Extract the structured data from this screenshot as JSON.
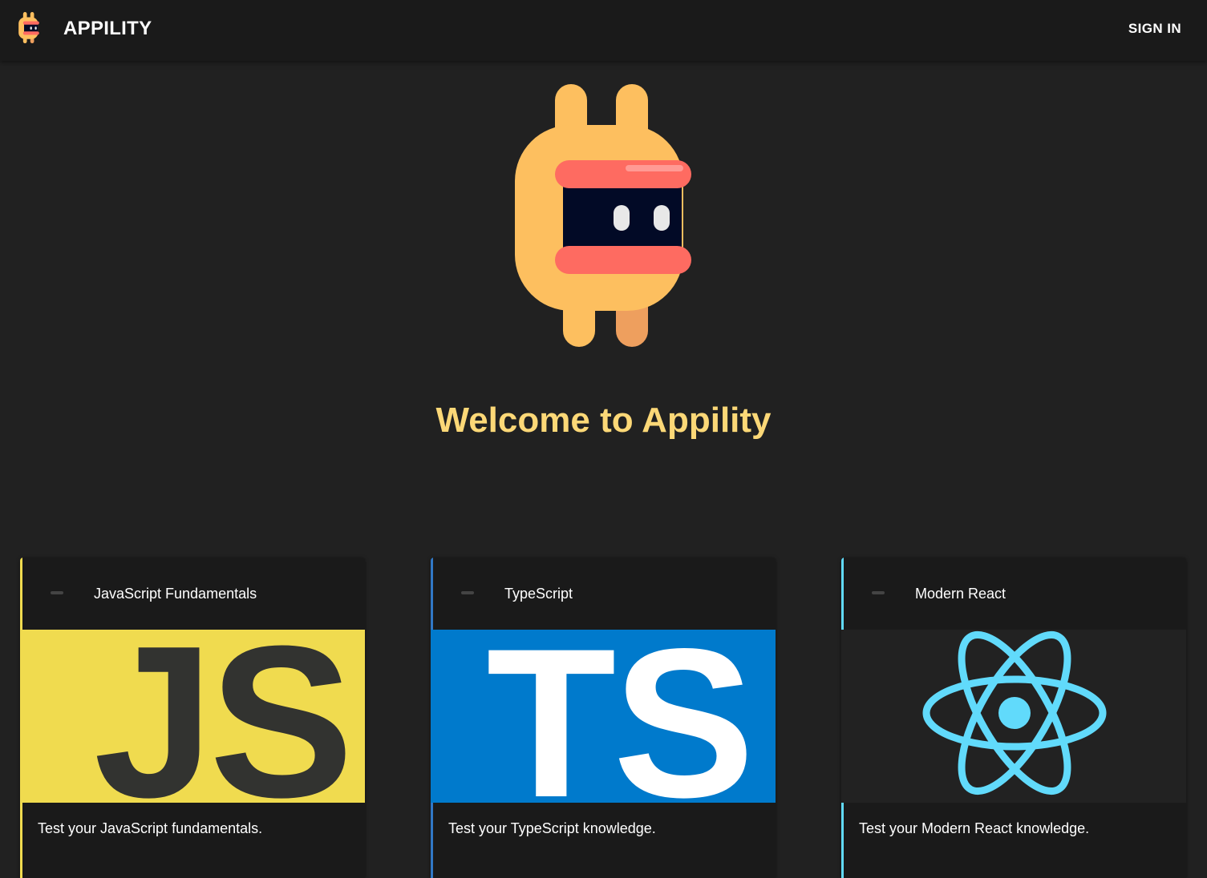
{
  "header": {
    "brand": "APPILITY",
    "sign_in_label": "SIGN IN",
    "logo_icon": "appility-logo-icon"
  },
  "hero": {
    "logo_icon": "appility-mascot-icon",
    "welcome": "Welcome to Appility"
  },
  "colors": {
    "background": "#212121",
    "appbar": "#1a1a1a",
    "welcome_text": "#fcd877",
    "mascot_body": "#fdbf5f",
    "mascot_band": "#fe6b61",
    "mascot_face": "#020a26"
  },
  "cards": [
    {
      "title": "JavaScript Fundamentals",
      "image_text": "JS",
      "description": "Test your JavaScript fundamentals.",
      "accent": "#f0db4f",
      "icon": "javascript-logo-icon"
    },
    {
      "title": "TypeScript",
      "image_text": "TS",
      "description": "Test your TypeScript knowledge.",
      "accent": "#3178c6",
      "icon": "typescript-logo-icon"
    },
    {
      "title": "Modern React",
      "image_text": "",
      "description": "Test your Modern React knowledge.",
      "accent": "#61dafb",
      "icon": "react-logo-icon"
    }
  ]
}
